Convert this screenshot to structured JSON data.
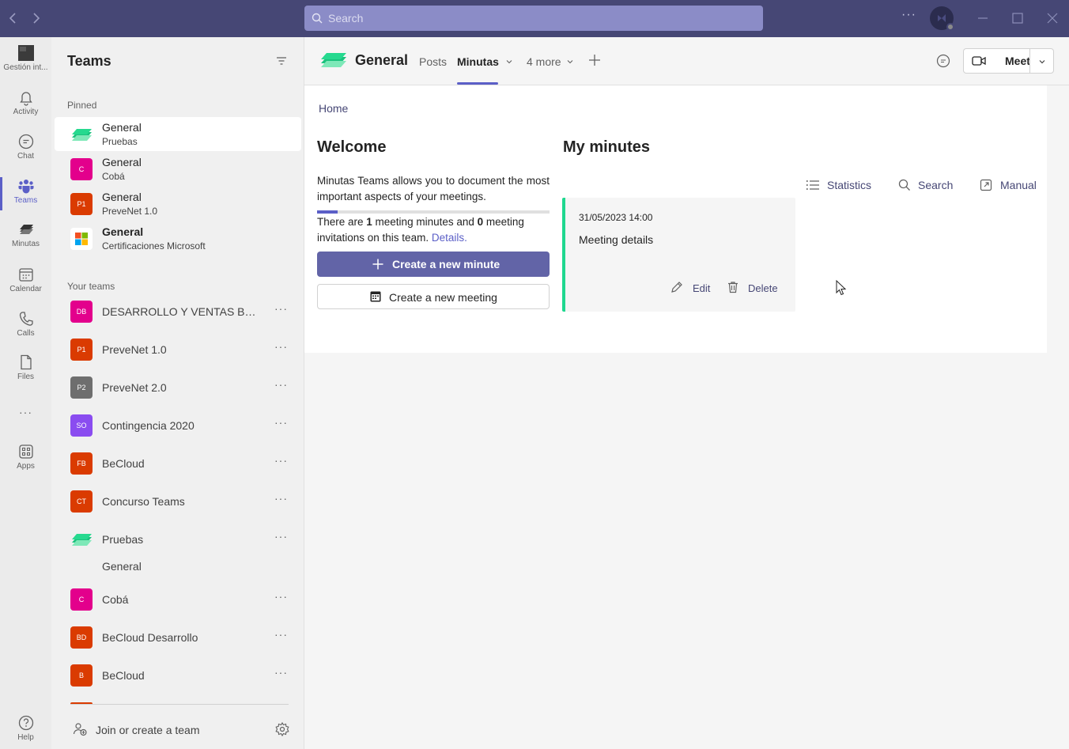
{
  "titlebar": {
    "search_placeholder": "Search",
    "more_label": "···"
  },
  "rail": {
    "items": [
      {
        "label": "Gestión int...",
        "icon": "org-icon"
      },
      {
        "label": "Activity",
        "icon": "bell-icon"
      },
      {
        "label": "Chat",
        "icon": "chat-icon"
      },
      {
        "label": "Teams",
        "icon": "teams-icon",
        "active": true
      },
      {
        "label": "Minutas",
        "icon": "minutas-icon"
      },
      {
        "label": "Calendar",
        "icon": "calendar-icon"
      },
      {
        "label": "Calls",
        "icon": "phone-icon"
      },
      {
        "label": "Files",
        "icon": "file-icon"
      },
      {
        "label": "Apps",
        "icon": "apps-icon"
      },
      {
        "label": "Help",
        "icon": "help-icon"
      }
    ],
    "more_label": "···"
  },
  "teams_panel": {
    "title": "Teams",
    "pinned_label": "Pinned",
    "your_teams_label": "Your teams",
    "pinned": [
      {
        "channel": "General",
        "team": "Pruebas"
      },
      {
        "channel": "General",
        "team": "Cobá",
        "initials": "C"
      },
      {
        "channel": "General",
        "team": "PreveNet 1.0",
        "initials": "P1"
      },
      {
        "channel": "General",
        "team": "Certificaciones Microsoft"
      }
    ],
    "teams": [
      {
        "name": "DESARROLLO Y VENTAS BE CL...",
        "initials": "DB",
        "color": "#e3008c"
      },
      {
        "name": "PreveNet 1.0",
        "initials": "P1",
        "color": "#da3b01"
      },
      {
        "name": "PreveNet 2.0",
        "initials": "P2",
        "color": "#6e6e6e"
      },
      {
        "name": "Contingencia 2020",
        "initials": "SO",
        "color": "#8a4cf0"
      },
      {
        "name": "BeCloud",
        "initials": "FB",
        "color": "#da3b01"
      },
      {
        "name": "Concurso Teams",
        "initials": "CT",
        "color": "#da3b01"
      },
      {
        "name": "Pruebas",
        "initials": "",
        "color": "#1fd88f"
      },
      {
        "name": "Cobá",
        "initials": "C",
        "color": "#e3008c"
      },
      {
        "name": "BeCloud Desarrollo",
        "initials": "BD",
        "color": "#da3b01"
      },
      {
        "name": "BeCloud",
        "initials": "B",
        "color": "#da3b01"
      }
    ],
    "channel_under_pruebas": "General",
    "more_label": "···",
    "join_label": "Join or create a team"
  },
  "header": {
    "title": "General",
    "tabs": [
      {
        "label": "Posts"
      },
      {
        "label": "Minutas",
        "active": true
      },
      {
        "label": "4 more"
      }
    ],
    "meet_label": "Meet"
  },
  "content": {
    "breadcrumb": "Home",
    "welcome_title": "Welcome",
    "welcome_text": "Minutas Teams allows you to document the most important aspects of your meetings.",
    "stats_prefix": "There are ",
    "minutes_count": "1",
    "stats_middle": " meeting minutes and ",
    "invites_count": "0",
    "stats_suffix": " meeting invitations on this team. ",
    "details_link": "Details.",
    "progress_fraction": 0.09,
    "create_minute_label": "Create a new minute",
    "create_meeting_label": "Create a new meeting",
    "my_minutes_title": "My minutes",
    "actions": {
      "statistics": "Statistics",
      "search": "Search",
      "manual": "Manual"
    },
    "minute_card": {
      "date": "31/05/2023 14:00",
      "title": "Meeting details",
      "edit_label": "Edit",
      "delete_label": "Delete"
    }
  },
  "colors": {
    "titlebar": "#464775",
    "accent": "#5b5fc7",
    "primary_button": "#6264a7",
    "card_border": "#1fd88f"
  }
}
